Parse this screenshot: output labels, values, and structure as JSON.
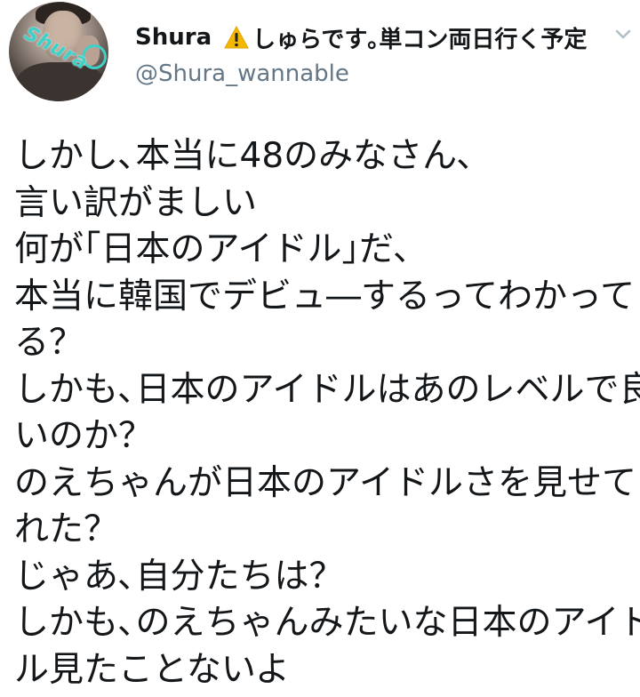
{
  "author": {
    "display_name": "Shura",
    "display_name_suffix": "しゅらです｡単コン両日行く予定",
    "handle": "@Shura_wannable",
    "warning_icon": "warning-sign-icon",
    "avatar_doodle_text": "Shura"
  },
  "menu": {
    "icon": "chevron-down-icon",
    "color": "#b0bec5"
  },
  "colors": {
    "text": "#14171a",
    "secondary": "#657786",
    "warning": "#f5b800"
  },
  "tweet": {
    "lines": [
      "しかし､本当に48のみなさん､",
      "言い訳がましい",
      "何が｢日本のアイドル｣だ､",
      "本当に韓国でデビュ―するってわかって",
      "る？",
      "しかも､日本のアイドルはあのレベルで良",
      "いのか？",
      "のえちゃんが日本のアイドルさを見せてく",
      "れた？",
      "じゃあ､自分たちは？",
      "しかも､のえちゃんみたいな日本のアイド",
      "ル見たことないよ"
    ]
  }
}
